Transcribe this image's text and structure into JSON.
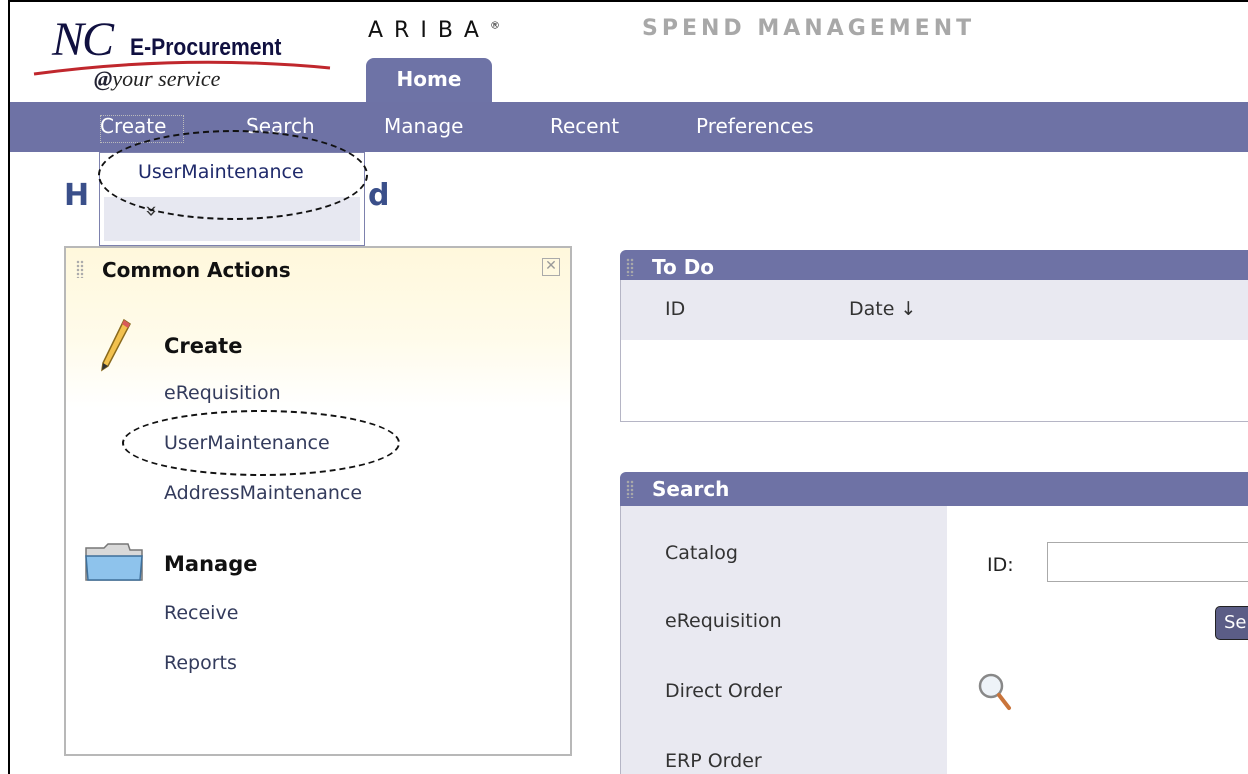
{
  "header": {
    "logo_nc": "NC",
    "logo_eprocurement": "E-Procurement",
    "logo_tagline_at": "@",
    "logo_tagline": "your service",
    "ariba": "ARIBA",
    "ariba_mark": "®",
    "spend_management": "SPEND MANAGEMENT",
    "home_tab": "Home"
  },
  "nav": {
    "items": [
      "Create",
      "Search",
      "Manage",
      "Recent",
      "Preferences"
    ]
  },
  "dropdown": {
    "item": "UserMaintenance",
    "more_icon": "double-chevron-down-icon",
    "more_glyph": "»"
  },
  "page": {
    "title_start": "H",
    "title_end": "d"
  },
  "common_actions": {
    "title": "Common Actions",
    "create": {
      "heading": "Create",
      "links": [
        "eRequisition",
        "UserMaintenance",
        "AddressMaintenance"
      ]
    },
    "manage": {
      "heading": "Manage",
      "links": [
        "Receive",
        "Reports"
      ]
    }
  },
  "todo": {
    "title": "To Do",
    "columns": [
      "ID",
      "Date ↓"
    ]
  },
  "search": {
    "title": "Search",
    "categories": [
      "Catalog",
      "eRequisition",
      "Direct Order",
      "ERP Order"
    ],
    "id_label": "ID:",
    "id_value": "",
    "button_label": "Se"
  },
  "colors": {
    "nav_bar": "#6e72a5",
    "link": "#333b5c",
    "title_blue": "#3a4f8a",
    "panel_light": "#e9e9f1"
  }
}
